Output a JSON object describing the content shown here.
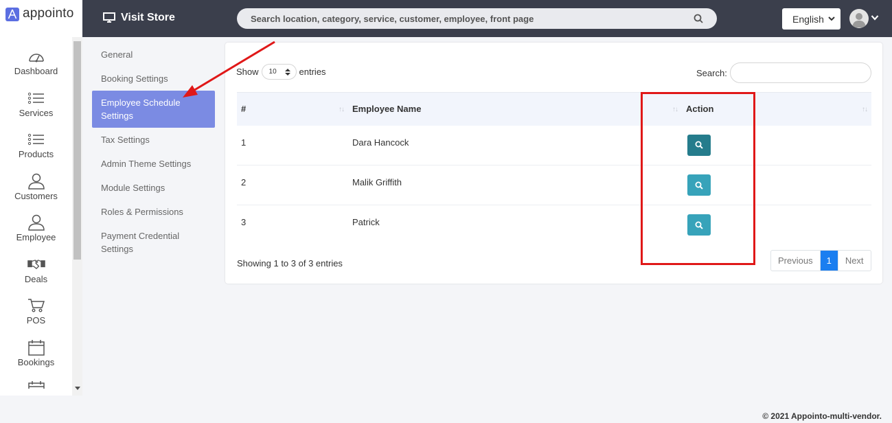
{
  "brand": {
    "name": "appointo"
  },
  "topbar": {
    "visit_store": "Visit Store",
    "search_placeholder": "Search location, category, service, customer, employee, front page",
    "language": "English"
  },
  "sidebar": {
    "items": [
      {
        "label": "Dashboard",
        "icon": "dashboard-icon"
      },
      {
        "label": "Services",
        "icon": "list-icon"
      },
      {
        "label": "Products",
        "icon": "list-icon"
      },
      {
        "label": "Customers",
        "icon": "user-icon"
      },
      {
        "label": "Employee",
        "icon": "user-icon"
      },
      {
        "label": "Deals",
        "icon": "handshake-icon"
      },
      {
        "label": "POS",
        "icon": "cart-icon"
      },
      {
        "label": "Bookings",
        "icon": "calendar-icon"
      }
    ]
  },
  "settings_menu": {
    "items": [
      "General",
      "Booking Settings",
      "Employee Schedule Settings",
      "Tax Settings",
      "Admin Theme Settings",
      "Module Settings",
      "Roles & Permissions",
      "Payment Credential Settings"
    ],
    "active_index": 2
  },
  "table": {
    "show_label": "Show",
    "entries_label": "entries",
    "page_length": "10",
    "search_label": "Search:",
    "columns": [
      "#",
      "Employee Name",
      "Action"
    ],
    "rows": [
      {
        "num": "1",
        "name": "Dara Hancock"
      },
      {
        "num": "2",
        "name": "Malik Griffith"
      },
      {
        "num": "3",
        "name": "Patrick"
      }
    ],
    "info": "Showing 1 to 3 of 3 entries",
    "pagination": {
      "previous": "Previous",
      "current": "1",
      "next": "Next"
    }
  },
  "colors": {
    "topbar": "#3b3f4c",
    "active_menu": "#7b8be3",
    "view_button": "#37a3ba",
    "view_button_hover": "#257c8c",
    "page_active": "#1a7ef0",
    "annotation": "#e01818"
  },
  "footer": {
    "text": "© 2021 Appointo-multi-vendor."
  }
}
